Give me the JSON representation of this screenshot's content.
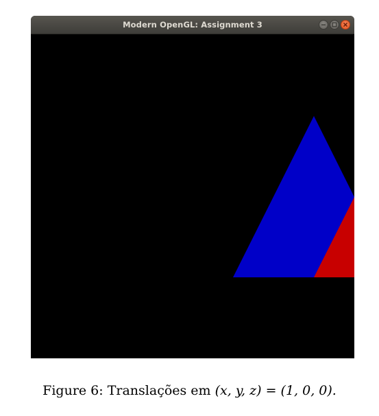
{
  "window": {
    "title": "Modern OpenGL: Assignment 3",
    "background": "#000000",
    "controls": [
      "minimize-icon",
      "maximize-icon",
      "close-icon"
    ]
  },
  "scene": {
    "triangles": [
      {
        "name": "blue-triangle",
        "color": "#0000c8"
      },
      {
        "name": "red-triangle",
        "color": "#c80000"
      }
    ]
  },
  "caption": {
    "label": "Figure 6:",
    "text": "Translações em",
    "expression": "(x, y, z) = (1, 0, 0)."
  }
}
